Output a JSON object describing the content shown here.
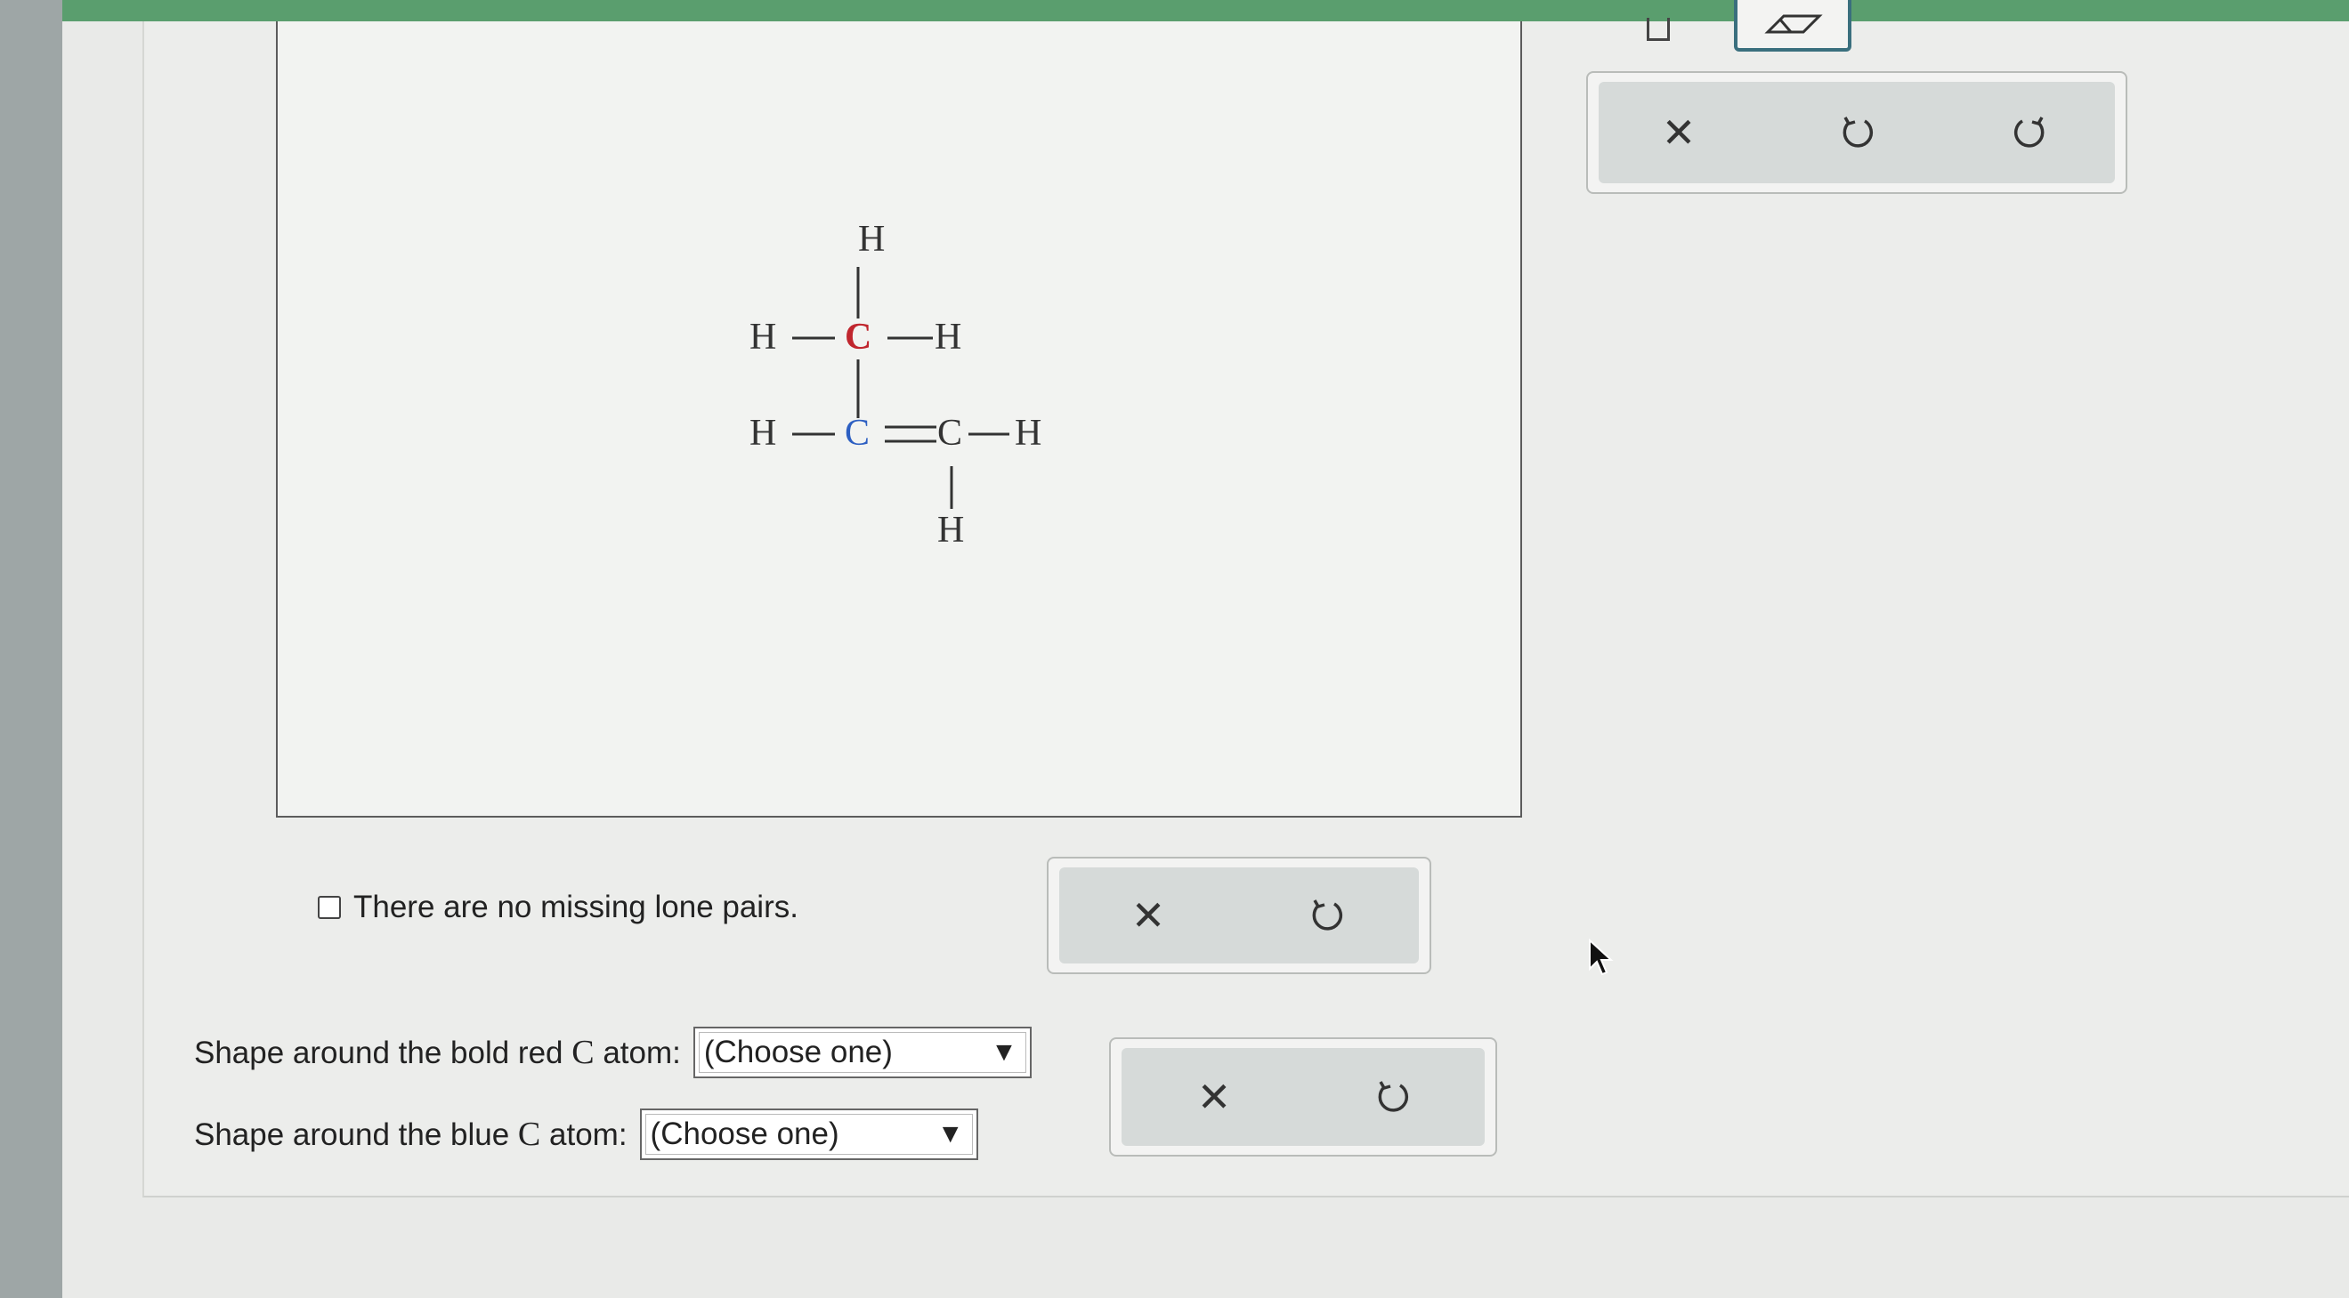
{
  "molecule": {
    "atoms": [
      "H",
      "H",
      "C",
      "H",
      "H",
      "C",
      "C",
      "H",
      "H"
    ],
    "red_atom": "C",
    "blue_atom": "C",
    "double_bond": "="
  },
  "lone_pairs": {
    "checkbox_label": "There are no missing lone pairs."
  },
  "questions": [
    {
      "prefix": "Shape around the bold red ",
      "atom": "C",
      "suffix": " atom:",
      "selected": "(Choose one)"
    },
    {
      "prefix": "Shape around the blue ",
      "atom": "C",
      "suffix": " atom:",
      "selected": "(Choose one)"
    }
  ],
  "toolbox_top": {
    "buttons": [
      "close-icon",
      "undo-icon",
      "redo-icon"
    ]
  },
  "toolbox_mid": {
    "buttons": [
      "close-icon",
      "undo-icon"
    ]
  },
  "toolbox_bot": {
    "buttons": [
      "close-icon",
      "undo-icon"
    ]
  },
  "colors": {
    "red_atom": "#c0262e",
    "blue_atom": "#2d5fc2",
    "top_bar": "#5a9e6e"
  }
}
